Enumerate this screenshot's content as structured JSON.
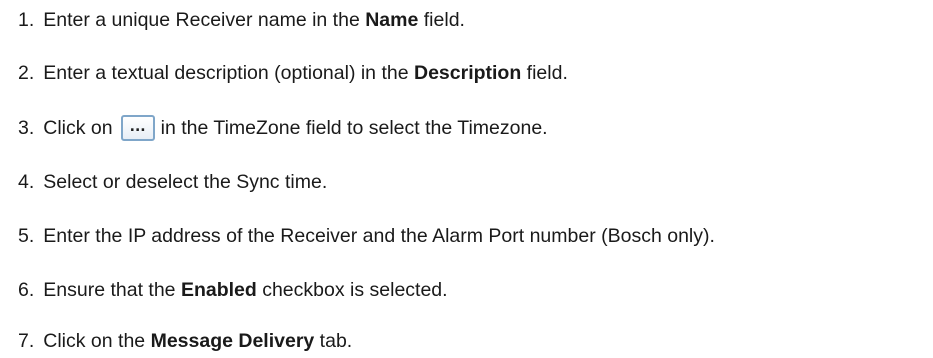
{
  "steps": [
    {
      "num": "1.",
      "a": "Enter a unique Receiver name in the ",
      "b": "Name",
      "c": " field."
    },
    {
      "num": "2.",
      "a": "Enter a textual description (optional) in the ",
      "b": "Description",
      "c": " field."
    },
    {
      "num": "3.",
      "a": "Click on",
      "button": "...",
      "c": "in the TimeZone field to select the Timezone."
    },
    {
      "num": "4.",
      "a": "Select or deselect the Sync time."
    },
    {
      "num": "5.",
      "a": "Enter the IP address of the Receiver and the Alarm Port number (Bosch only)."
    },
    {
      "num": "6.",
      "a": "Ensure that the ",
      "b": "Enabled",
      "c": " checkbox is selected."
    },
    {
      "num": "7.",
      "a": "Click on the ",
      "b": "Message Delivery",
      "c": " tab."
    }
  ],
  "colors": {
    "text": "#1a1a1a",
    "button_border": "#7fa6c9"
  },
  "icons": {
    "timezone_button": "ellipsis-icon"
  }
}
